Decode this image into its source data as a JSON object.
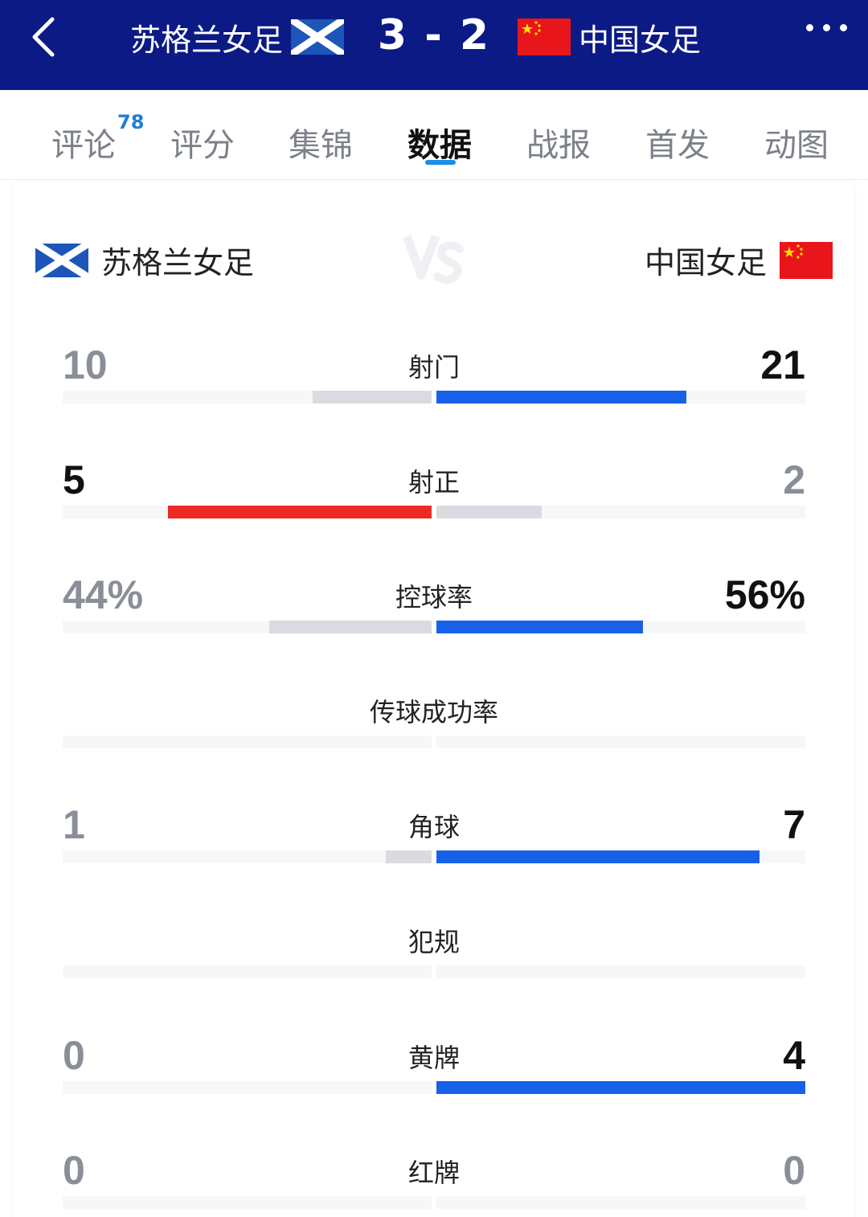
{
  "header": {
    "home_team": "苏格兰女足",
    "away_team": "中国女足",
    "score": "3 - 2"
  },
  "tabs": [
    {
      "label": "评论",
      "badge": "78"
    },
    {
      "label": "评分"
    },
    {
      "label": "集锦"
    },
    {
      "label": "数据",
      "active": true
    },
    {
      "label": "战报"
    },
    {
      "label": "首发"
    },
    {
      "label": "动图"
    }
  ],
  "teams": {
    "home": "苏格兰女足",
    "away": "中国女足"
  },
  "colors": {
    "header_bg": "#0c1a86",
    "away_bar": "#1761e8",
    "home_bar": "#ee2a24",
    "loser_bar": "#d9dbe0",
    "track": "#f6f7f9",
    "tab_indicator": "#1a8fe6"
  },
  "stats": [
    {
      "label": "射门",
      "home": "10",
      "away": "21",
      "home_frac": 0.323,
      "away_frac": 0.677,
      "leader": "away"
    },
    {
      "label": "射正",
      "home": "5",
      "away": "2",
      "home_frac": 0.714,
      "away_frac": 0.286,
      "leader": "home"
    },
    {
      "label": "控球率",
      "home": "44%",
      "away": "56%",
      "home_frac": 0.44,
      "away_frac": 0.56,
      "leader": "away"
    },
    {
      "label": "传球成功率",
      "home": "",
      "away": "",
      "home_frac": 0,
      "away_frac": 0,
      "leader": "none"
    },
    {
      "label": "角球",
      "home": "1",
      "away": "7",
      "home_frac": 0.125,
      "away_frac": 0.875,
      "leader": "away"
    },
    {
      "label": "犯规",
      "home": "",
      "away": "",
      "home_frac": 0,
      "away_frac": 0,
      "leader": "none"
    },
    {
      "label": "黄牌",
      "home": "0",
      "away": "4",
      "home_frac": 0,
      "away_frac": 1.0,
      "leader": "away"
    },
    {
      "label": "红牌",
      "home": "0",
      "away": "0",
      "home_frac": 0,
      "away_frac": 0,
      "leader": "none"
    }
  ]
}
